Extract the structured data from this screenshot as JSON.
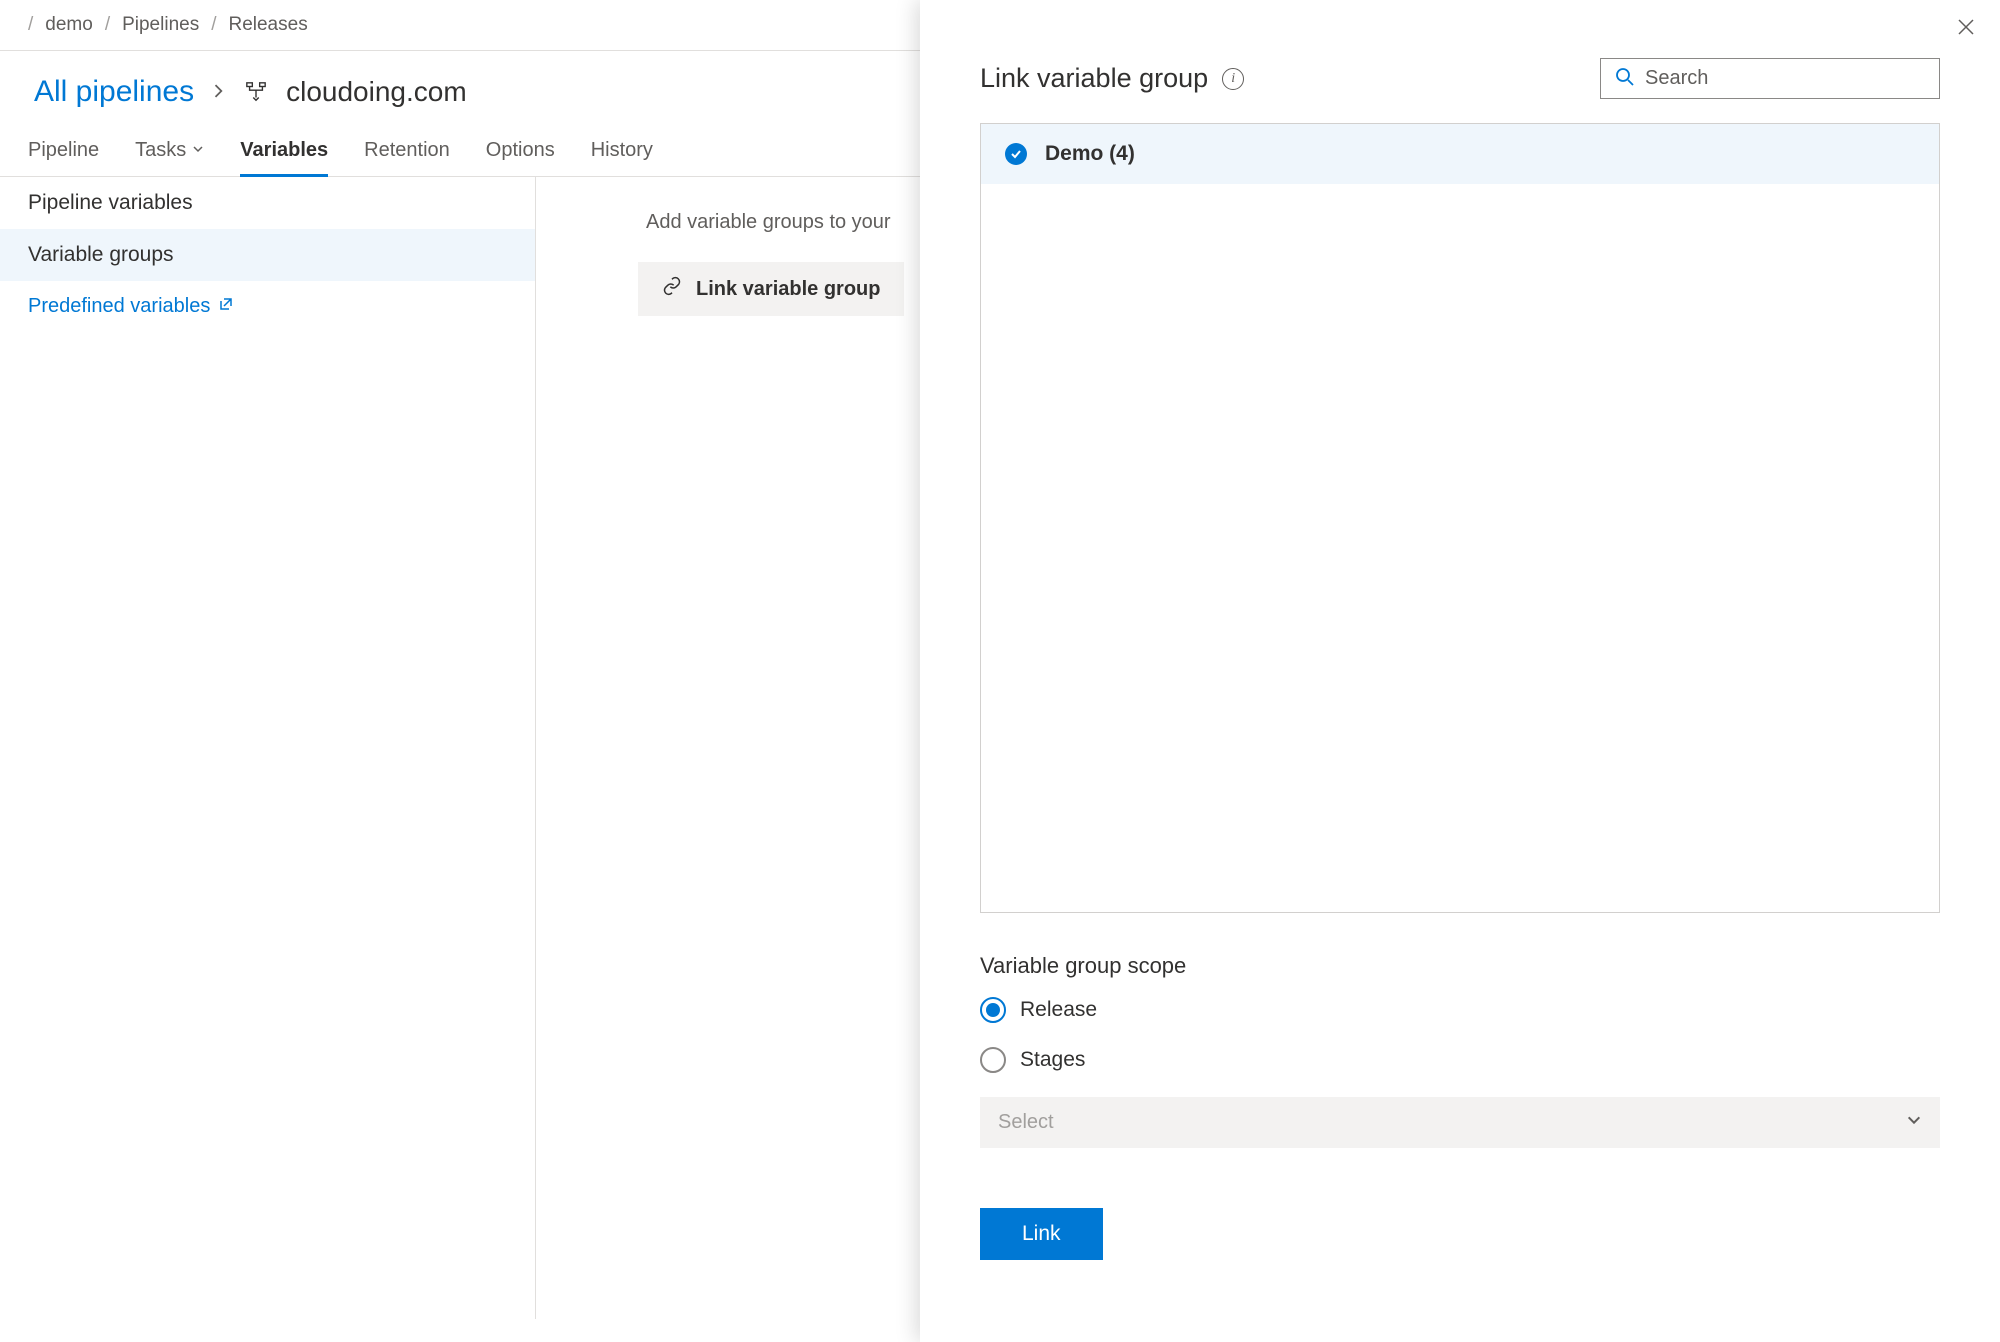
{
  "breadcrumb": {
    "items": [
      "demo",
      "Pipelines",
      "Releases"
    ]
  },
  "header": {
    "all_pipelines": "All pipelines",
    "pipeline_name": "cloudoing.com"
  },
  "tabs": {
    "pipeline": "Pipeline",
    "tasks": "Tasks",
    "variables": "Variables",
    "retention": "Retention",
    "options": "Options",
    "history": "History"
  },
  "sidebar": {
    "pipeline_vars": "Pipeline variables",
    "variable_groups": "Variable groups",
    "predefined": "Predefined variables"
  },
  "main": {
    "hint": "Add variable groups to your",
    "link_btn": "Link variable group"
  },
  "panel": {
    "title": "Link variable group",
    "search_placeholder": "Search",
    "item_label": "Demo (4)",
    "scope_title": "Variable group scope",
    "radio_release": "Release",
    "radio_stages": "Stages",
    "select_placeholder": "Select",
    "link_button": "Link"
  }
}
